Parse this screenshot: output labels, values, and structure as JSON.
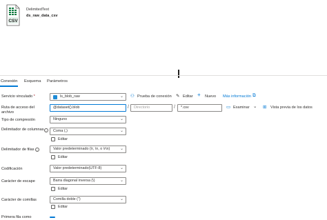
{
  "dataset": {
    "type_label": "DelimitedText",
    "name": "ds_raw_data_csv",
    "icon_label": "CSV"
  },
  "tabs": [
    {
      "label": "Conexión",
      "active": true
    },
    {
      "label": "Esquema",
      "active": false
    },
    {
      "label": "Parámetros",
      "active": false
    }
  ],
  "linked_service": {
    "label": "Servicio vinculado",
    "required_mark": "*",
    "value": "ls_blob_raw",
    "test_connection": "Prueba de conexión",
    "edit": "Editar",
    "new": "Nuevo",
    "more_info": "Más información"
  },
  "file_path": {
    "label": "Ruta de acceso del archivo",
    "container": "@dataset().blob",
    "directory_placeholder": "Directorio",
    "file_placeholder": "*.csv",
    "browse": "Examinar",
    "preview": "Vista previa de los datos"
  },
  "compression": {
    "label": "Tipo de compresión",
    "value": "Ninguno"
  },
  "column_delimiter": {
    "label": "Delimitador de columnas",
    "value": "Coma (,)",
    "edit_label": "Editar"
  },
  "row_delimiter": {
    "label": "Delimitador de filas",
    "value": "Valor predeterminado (\\r, \\n, o \\r\\n)",
    "edit_label": "Editar"
  },
  "encoding": {
    "label": "Codificación",
    "value": "Valor predeterminado(UTF-8)"
  },
  "escape_char": {
    "label": "Carácter de escape",
    "value": "Barra diagonal inversa (\\)",
    "edit_label": "Editar"
  },
  "quote_char": {
    "label": "Carácter de comillas",
    "value": "Comilla doble (\")",
    "edit_label": "Editar"
  },
  "first_row_header": {
    "label": "Primera fila como"
  },
  "colors": {
    "accent": "#0078d4",
    "csv_green": "#107c41"
  }
}
